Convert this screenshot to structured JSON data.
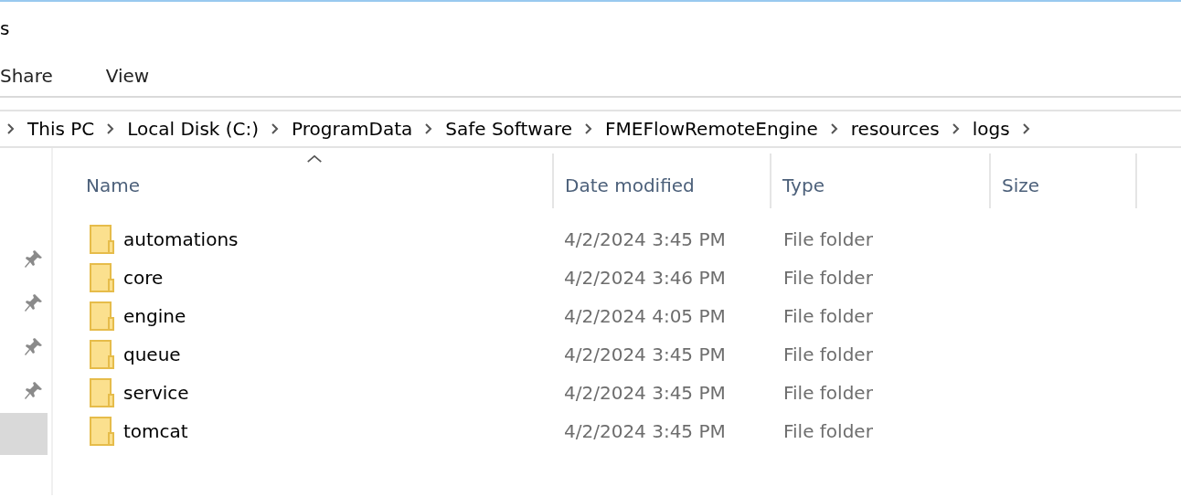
{
  "window": {
    "title": "s"
  },
  "ribbon_tabs": [
    {
      "label": "Share"
    },
    {
      "label": "View"
    }
  ],
  "address_bar": {
    "path": [
      "This PC",
      "Local Disk (C:)",
      "ProgramData",
      "Safe Software",
      "FMEFlowRemoteEngine",
      "resources",
      "logs"
    ]
  },
  "sidebar": {
    "items": [
      {
        "pinned": true,
        "selected": false
      },
      {
        "pinned": true,
        "selected": false
      },
      {
        "pinned": true,
        "selected": false
      },
      {
        "pinned": true,
        "selected": false
      },
      {
        "pinned": false,
        "selected": true
      }
    ]
  },
  "table": {
    "columns": [
      {
        "label": "Name",
        "sorted": true
      },
      {
        "label": "Date modified",
        "sorted": false
      },
      {
        "label": "Type",
        "sorted": false
      },
      {
        "label": "Size",
        "sorted": false
      }
    ],
    "rows": [
      {
        "name": "automations",
        "date_modified": "4/2/2024 3:45 PM",
        "type": "File folder"
      },
      {
        "name": "core",
        "date_modified": "4/2/2024 3:46 PM",
        "type": "File folder"
      },
      {
        "name": "engine",
        "date_modified": "4/2/2024 4:05 PM",
        "type": "File folder"
      },
      {
        "name": "queue",
        "date_modified": "4/2/2024 3:45 PM",
        "type": "File folder"
      },
      {
        "name": "service",
        "date_modified": "4/2/2024 3:45 PM",
        "type": "File folder"
      },
      {
        "name": "tomcat",
        "date_modified": "4/2/2024 3:45 PM",
        "type": "File folder"
      }
    ]
  }
}
